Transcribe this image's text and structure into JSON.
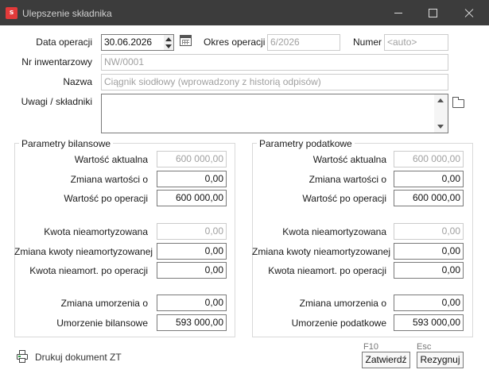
{
  "window": {
    "app_icon_letter": "s",
    "title": "Ulepszenie składnika"
  },
  "header": {
    "date_label": "Data operacji",
    "date_value": "30.06.2026",
    "period_label": "Okres operacji",
    "period_value": "6/2026",
    "number_label": "Numer",
    "number_value": "<auto>",
    "inventory_label": "Nr inwentarzowy",
    "inventory_value": "NW/0001",
    "name_label": "Nazwa",
    "name_value": "Ciągnik siodłowy (wprowadzony z historią odpisów)",
    "notes_label": "Uwagi / składniki",
    "notes_value": ""
  },
  "bilansowe": {
    "title": "Parametry bilansowe",
    "rows": [
      {
        "label": "Wartość aktualna",
        "value": "600 000,00"
      },
      {
        "label": "Zmiana wartości o",
        "value": "0,00"
      },
      {
        "label": "Wartość po operacji",
        "value": "600 000,00"
      },
      {
        "label": "Kwota nieamortyzowana",
        "value": "0,00"
      },
      {
        "label": "Zmiana kwoty nieamortyzowanej",
        "value": "0,00"
      },
      {
        "label": "Kwota nieamort. po operacji",
        "value": "0,00"
      },
      {
        "label": "Zmiana umorzenia o",
        "value": "0,00"
      },
      {
        "label": "Umorzenie bilansowe",
        "value": "593 000,00"
      }
    ]
  },
  "podatkowe": {
    "title": "Parametry podatkowe",
    "rows": [
      {
        "label": "Wartość aktualna",
        "value": "600 000,00"
      },
      {
        "label": "Zmiana wartości o",
        "value": "0,00"
      },
      {
        "label": "Wartość po operacji",
        "value": "600 000,00"
      },
      {
        "label": "Kwota nieamortyzowana",
        "value": "0,00"
      },
      {
        "label": "Zmiana kwoty nieamortyzowanej",
        "value": "0,00"
      },
      {
        "label": "Kwota nieamort. po operacji",
        "value": "0,00"
      },
      {
        "label": "Zmiana umorzenia o",
        "value": "0,00"
      },
      {
        "label": "Umorzenie podatkowe",
        "value": "593 000,00"
      }
    ]
  },
  "footer": {
    "print_label": "Drukuj dokument ZT",
    "confirm_hotkey": "F10",
    "confirm_label": "Zatwierdź",
    "cancel_hotkey": "Esc",
    "cancel_label": "Rezygnuj"
  }
}
